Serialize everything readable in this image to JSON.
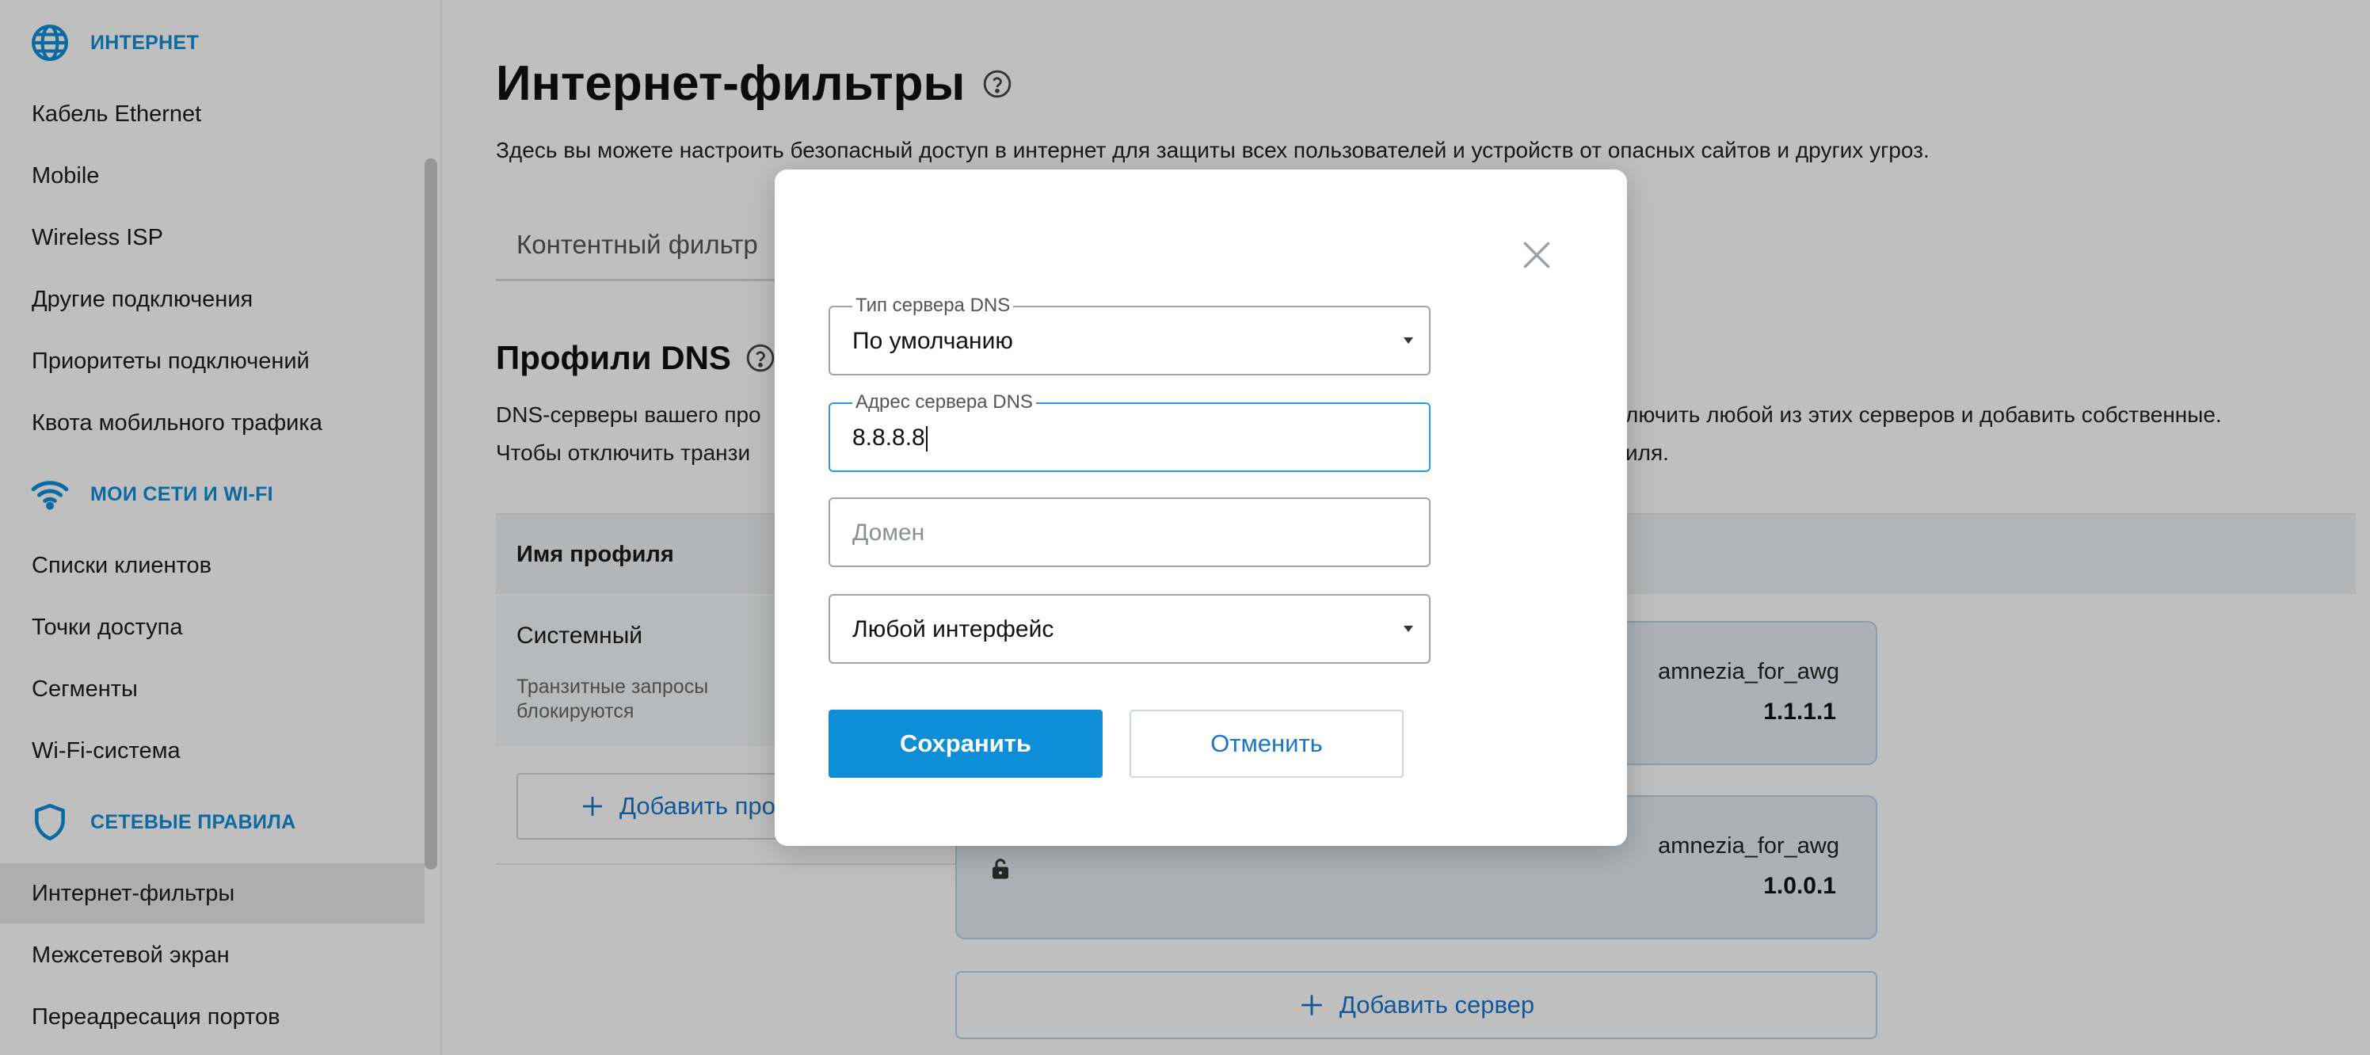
{
  "sidebar": {
    "sections": {
      "internet": "ИНТЕРНЕТ",
      "networks": "МОИ СЕТИ И WI-FI",
      "rules": "СЕТЕВЫЕ ПРАВИЛА"
    },
    "items": [
      "Кабель Ethernet",
      "Mobile",
      "Wireless ISP",
      "Другие подключения",
      "Приоритеты подключений",
      "Квота мобильного трафика",
      "Списки клиентов",
      "Точки доступа",
      "Сегменты",
      "Wi-Fi-система",
      "Интернет-фильтры",
      "Межсетевой экран",
      "Переадресация портов"
    ],
    "active_item": "Интернет-фильтры"
  },
  "main": {
    "title": "Интернет-фильтры",
    "subtitle": "Здесь вы можете настроить безопасный доступ в интернет для защиты всех пользователей и устройств от опасных сайтов и других угроз.",
    "tab_label": "Контентный фильтр",
    "dns_title": "Профили DNS",
    "desc_line1_left": "DNS-серверы вашего про",
    "desc_line1_right": "лючить любой из этих серверов и добавить собственные.",
    "desc_line2_left": "Чтобы отключить транзи",
    "desc_line2_right": "иля.",
    "table_header": "Имя профиля",
    "profile": {
      "name": "Системный",
      "note": "Транзитные запросы блокируются"
    },
    "add_profile": "Добавить про",
    "servers": [
      {
        "name": "amnezia_for_awg",
        "ip": "1.1.1.1"
      },
      {
        "name": "amnezia_for_awg",
        "ip": "1.0.0.1"
      }
    ],
    "add_server": "Добавить сервер"
  },
  "modal": {
    "dns_type": {
      "legend": "Тип сервера DNS",
      "value": "По умолчанию"
    },
    "dns_address": {
      "legend": "Адрес сервера DNS",
      "value": "8.8.8.8"
    },
    "domain": {
      "placeholder": "Домен"
    },
    "interface": {
      "value": "Любой интерфейс"
    },
    "save": "Сохранить",
    "cancel": "Отменить"
  },
  "colors": {
    "accent": "#0f8ed8",
    "link": "#1976c8",
    "card_bg": "#e4ecf3",
    "active_bg": "#e8e9ea"
  },
  "icons": [
    "globe-icon",
    "wifi-icon",
    "shield-icon",
    "help-icon",
    "plus-icon",
    "lock-icon",
    "close-icon",
    "dropdown-arrow-icon"
  ]
}
